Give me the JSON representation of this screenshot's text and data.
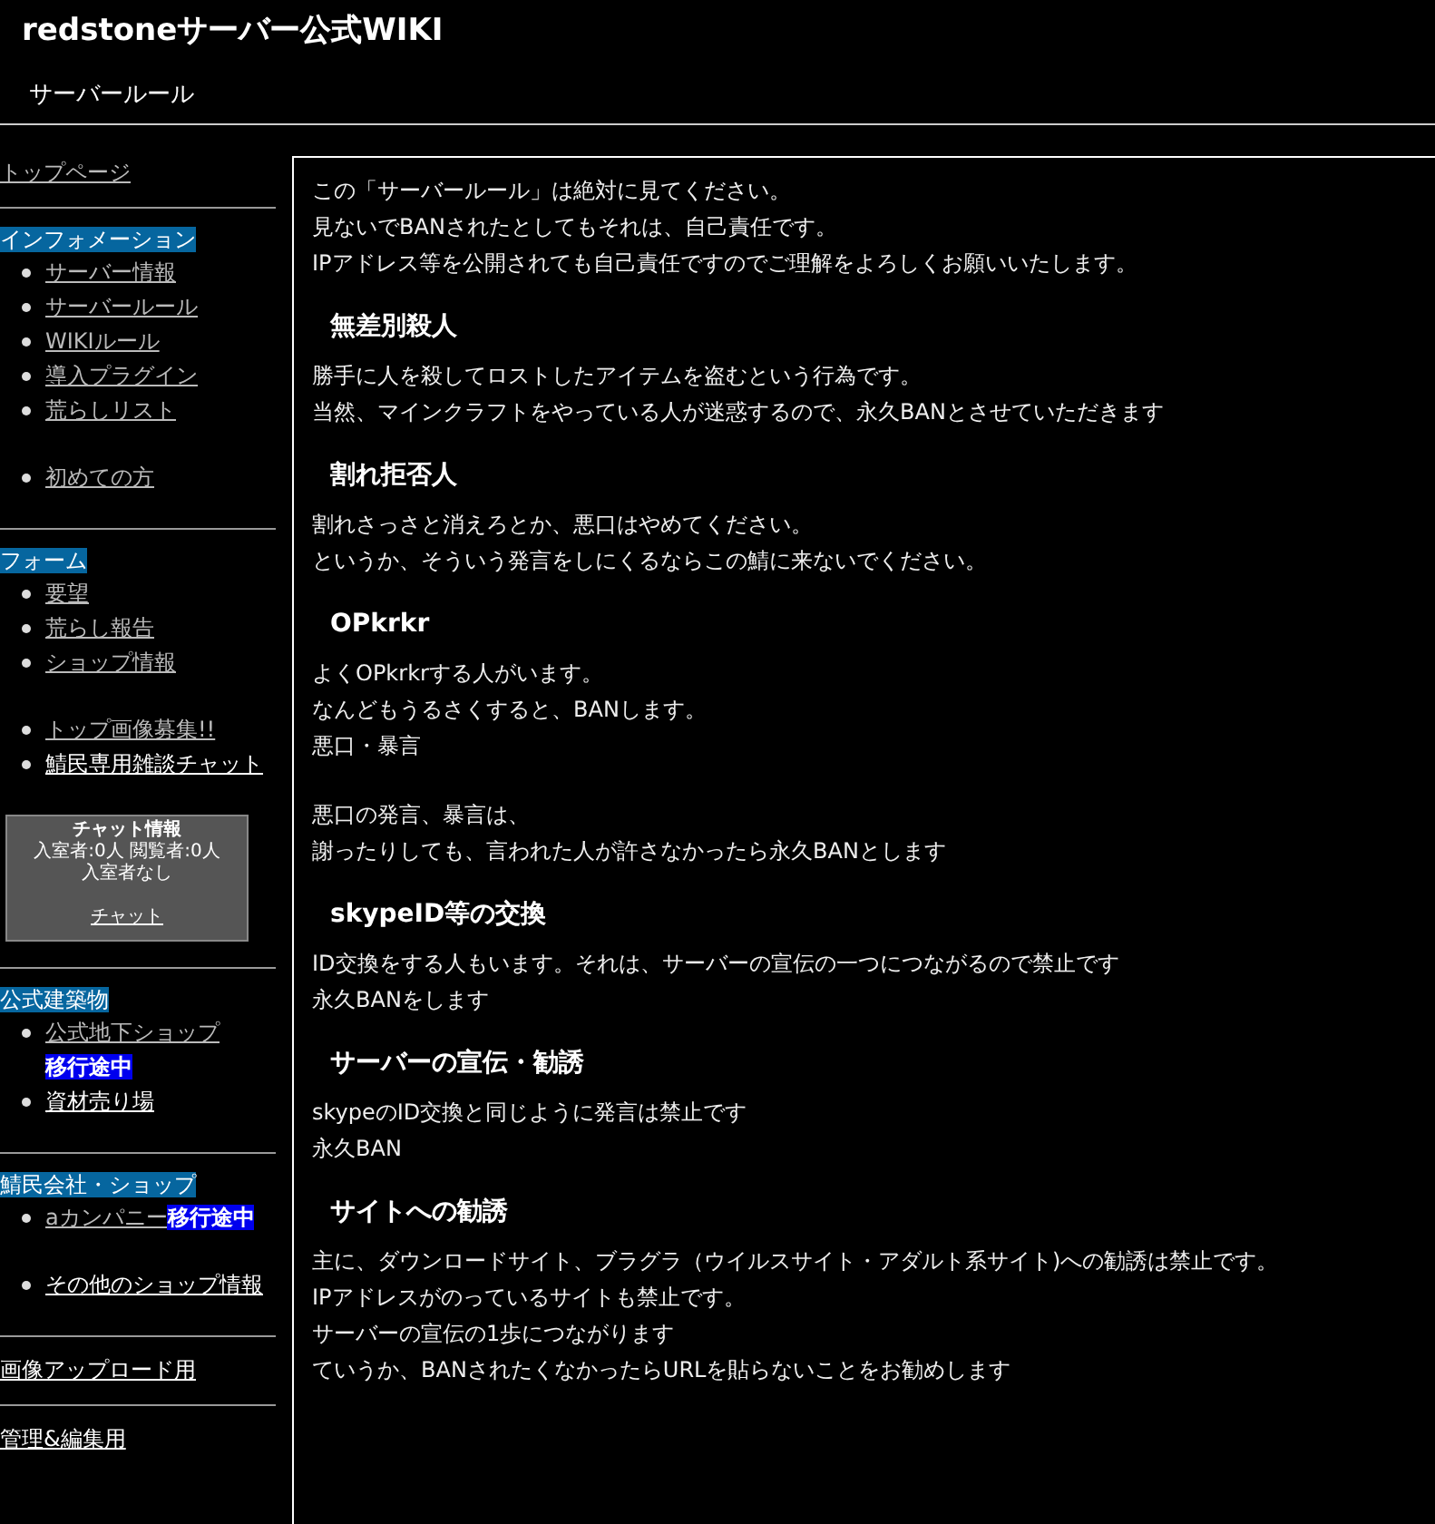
{
  "site_title": "redstoneサーバー公式WIKI",
  "page_title": "サーバールール",
  "sidebar": [
    {
      "kind": "link",
      "label": "トップページ",
      "visited": true
    },
    {
      "kind": "rule"
    },
    {
      "kind": "heading",
      "label": "インフォメーション"
    },
    {
      "kind": "list",
      "items": [
        {
          "label": "サーバー情報",
          "visited": true
        },
        {
          "label": "サーバールール",
          "visited": true
        },
        {
          "label": "WIKIルール",
          "visited": true
        },
        {
          "label": "導入プラグイン",
          "visited": true
        },
        {
          "label": "荒らしリスト",
          "visited": true
        }
      ]
    },
    {
      "kind": "list",
      "items": [
        {
          "label": "初めての方",
          "visited": true
        }
      ]
    },
    {
      "kind": "rule"
    },
    {
      "kind": "heading",
      "label": "フォーム"
    },
    {
      "kind": "list",
      "items": [
        {
          "label": "要望",
          "visited": true
        },
        {
          "label": "荒らし報告",
          "visited": true
        },
        {
          "label": "ショップ情報",
          "visited": true
        }
      ]
    },
    {
      "kind": "list",
      "items": [
        {
          "label": "トップ画像募集!!",
          "visited": true
        },
        {
          "label": "鯖民専用雑談チャット",
          "visited": false
        }
      ]
    },
    {
      "kind": "chat",
      "title": "チャット情報",
      "counts": "入室者:0人 閲覧者:0人",
      "status": "入室者なし",
      "link": "チャット"
    },
    {
      "kind": "rule"
    },
    {
      "kind": "heading",
      "label": "公式建築物"
    },
    {
      "kind": "list",
      "items": [
        {
          "label": "公式地下ショップ",
          "visited": true,
          "badge": "移行途中"
        },
        {
          "label": "資材売り場",
          "visited": false
        }
      ]
    },
    {
      "kind": "rule"
    },
    {
      "kind": "heading",
      "label": "鯖民会社・ショップ"
    },
    {
      "kind": "list",
      "items": [
        {
          "label": "aカンパニー",
          "visited": true,
          "badge": "移行途中"
        }
      ]
    },
    {
      "kind": "list",
      "items": [
        {
          "label": "その他のショップ情報",
          "visited": false
        }
      ]
    },
    {
      "kind": "rule"
    },
    {
      "kind": "link",
      "label": "画像アップロード用",
      "visited": false
    },
    {
      "kind": "rule"
    },
    {
      "kind": "link",
      "label": "管理&編集用",
      "visited": false
    }
  ],
  "content": {
    "intro": [
      "この「サーバールール」は絶対に見てください。",
      "見ないでBANされたとしてもそれは、自己責任です。",
      "IPアドレス等を公開されても自己責任ですのでご理解をよろしくお願いいたします。"
    ],
    "sections": [
      {
        "heading": "無差別殺人",
        "paragraphs": [
          [
            "勝手に人を殺してロストしたアイテムを盗むという行為です。",
            "当然、マインクラフトをやっている人が迷惑するので、永久BANとさせていただきます"
          ]
        ]
      },
      {
        "heading": "割れ拒否人",
        "paragraphs": [
          [
            "割れさっさと消えろとか、悪口はやめてください。",
            "というか、そういう発言をしにくるならこの鯖に来ないでください。"
          ]
        ]
      },
      {
        "heading": "OPkrkr",
        "paragraphs": [
          [
            "よくOPkrkrする人がいます。",
            "なんどもうるさくすると、BANします。",
            "悪口・暴言"
          ],
          [
            "悪口の発言、暴言は、",
            "謝ったりしても、言われた人が許さなかったら永久BANとします"
          ]
        ]
      },
      {
        "heading": "skypeID等の交換",
        "paragraphs": [
          [
            "ID交換をする人もいます。それは、サーバーの宣伝の一つにつながるので禁止です",
            "永久BANをします"
          ]
        ]
      },
      {
        "heading": "サーバーの宣伝・勧誘",
        "paragraphs": [
          [
            "skypeのID交換と同じように発言は禁止です",
            "永久BAN"
          ]
        ]
      },
      {
        "heading": "サイトへの勧誘",
        "paragraphs": [
          [
            "主に、ダウンロードサイト、ブラグラ（ウイルスサイト・アダルト系サイト)への勧誘は禁止です。",
            "IPアドレスがのっているサイトも禁止です。",
            "サーバーの宣伝の1歩につながります",
            "ていうか、BANされたくなかったらURLを貼らないことをお勧めします"
          ]
        ]
      }
    ]
  }
}
